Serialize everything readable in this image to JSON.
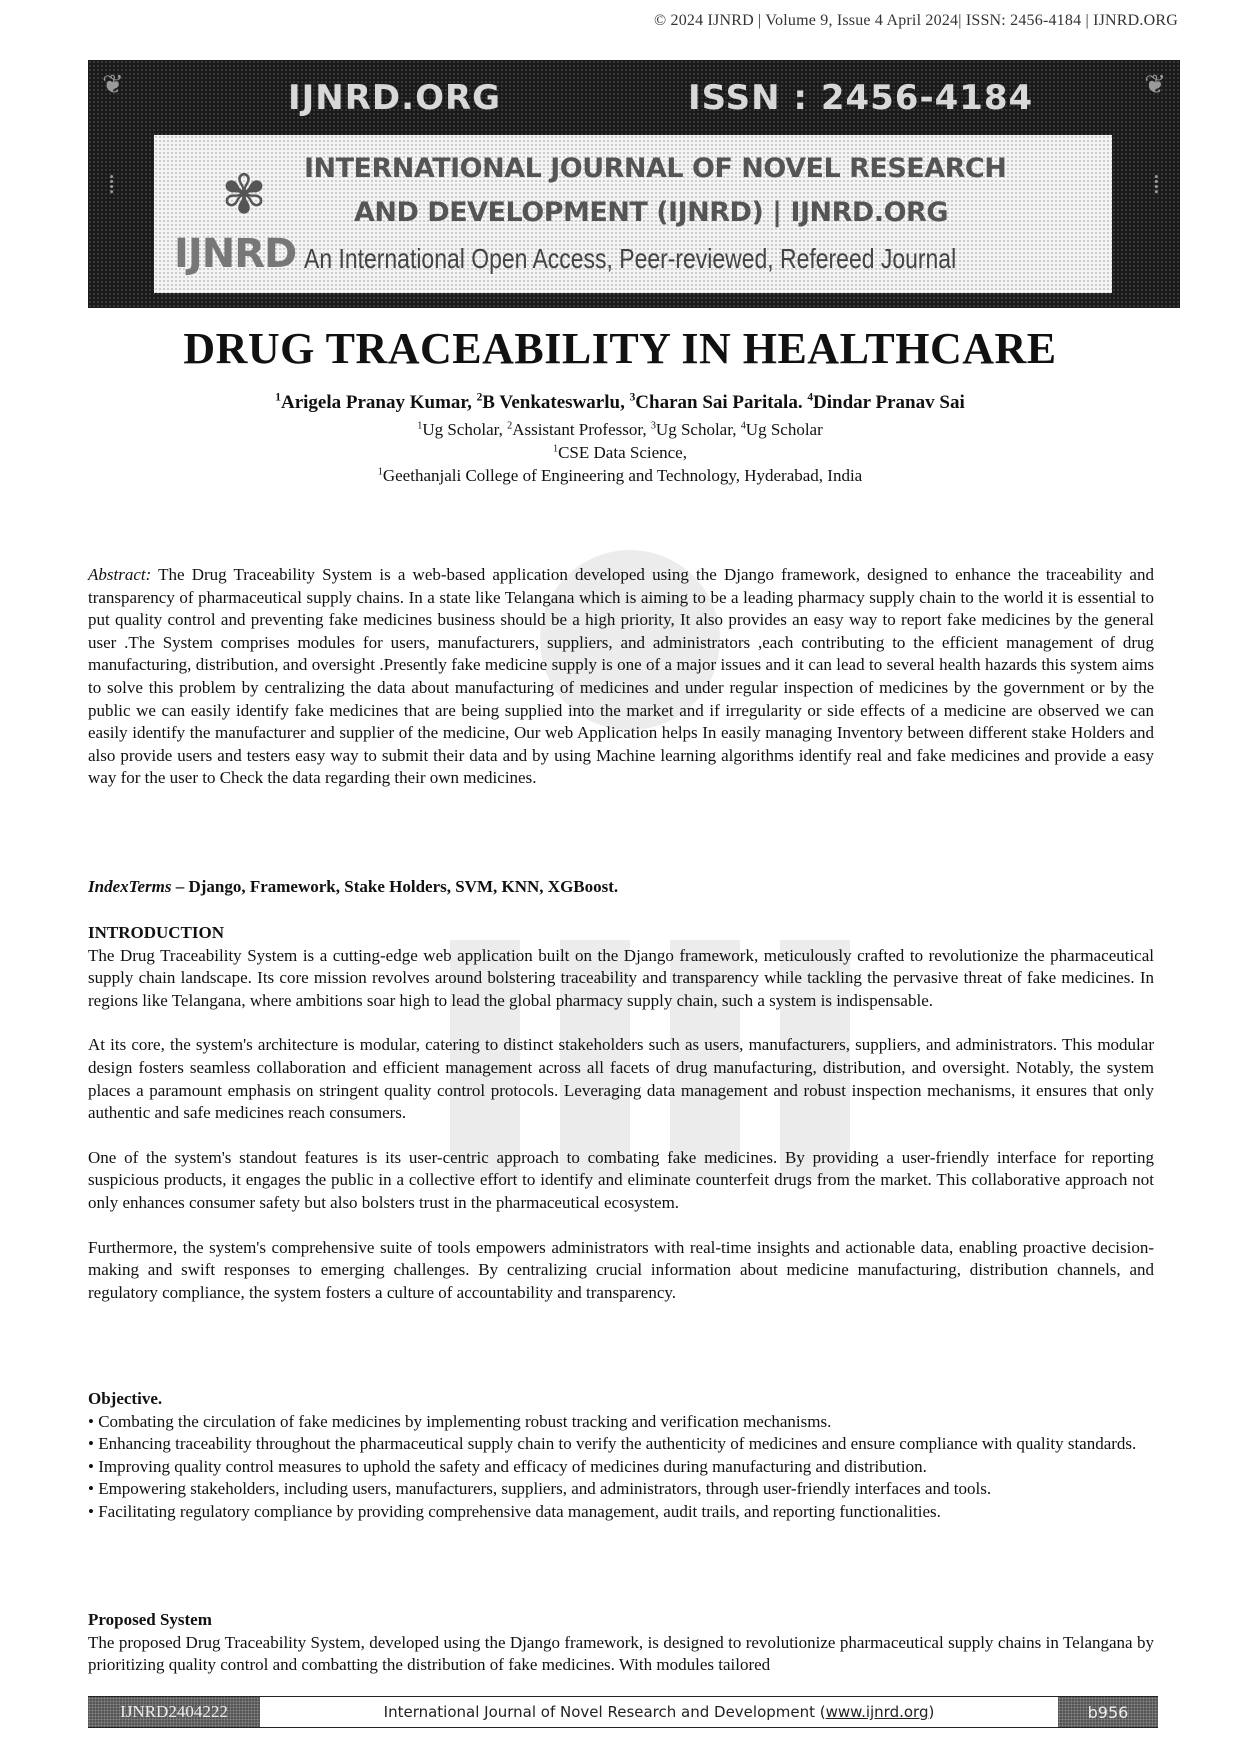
{
  "header_line": "© 2024 IJNRD | Volume 9, Issue 4 April 2024| ISSN: 2456-4184 | IJNRD.ORG",
  "banner": {
    "site": "IJNRD.ORG",
    "issn": "ISSN : 2456-4184",
    "journal_line1": "INTERNATIONAL JOURNAL OF NOVEL RESEARCH",
    "journal_line2": "AND DEVELOPMENT (IJNRD) | IJNRD.ORG",
    "tagline": "An International Open Access, Peer-reviewed, Refereed Journal",
    "logo_text": "IJNRD"
  },
  "paper": {
    "title": "DRUG TRACEABILITY IN HEALTHCARE",
    "authors": [
      {
        "sup": "1",
        "name": "Arigela Pranay Kumar, "
      },
      {
        "sup": "2",
        "name": "B Venkateswarlu, "
      },
      {
        "sup": "3",
        "name": "Charan Sai Paritala. "
      },
      {
        "sup": "4",
        "name": "Dindar Pranav Sai"
      }
    ],
    "roles": [
      {
        "sup": "1",
        "text": "Ug Scholar, "
      },
      {
        "sup": "2",
        "text": "Assistant Professor, "
      },
      {
        "sup": "3",
        "text": "Ug Scholar, "
      },
      {
        "sup": "4",
        "text": "Ug Scholar"
      }
    ],
    "dept": {
      "sup": "1",
      "text": "CSE Data Science,"
    },
    "institution": {
      "sup": "1",
      "text": "Geethanjali College of Engineering and Technology, Hyderabad, India"
    },
    "abstract_label": "Abstract:",
    "abstract": "The Drug Traceability System is a web-based application developed using the Django framework, designed to enhance the traceability and transparency of pharmaceutical supply chains. In a state like Telangana which is aiming to be a leading pharmacy supply chain to the world it is essential to put quality control and preventing fake medicines business should be a high priority, It also provides an easy way to report fake medicines by the general user .The System comprises modules for users, manufacturers, suppliers, and administrators ,each contributing to the efficient management of drug manufacturing, distribution, and oversight .Presently fake medicine supply is one of a major issues and it can lead to several health hazards this system aims to solve this problem by centralizing the data about manufacturing of medicines and under regular inspection of medicines by the government or by the public we can easily identify fake medicines that are being supplied into the market and if irregularity or side effects of a medicine are observed we can easily identify the manufacturer and supplier of the medicine, Our web Application helps In easily managing Inventory between different stake Holders and also provide users and testers easy way to submit their data and by using Machine learning algorithms identify real and fake medicines and provide a easy way for the user to Check the data regarding their own medicines.",
    "index_terms_label": "IndexTerms",
    "index_terms": " – Django, Framework, Stake Holders, SVM, KNN, XGBoost.",
    "intro_heading": "INTRODUCTION",
    "intro_paragraphs": [
      "The Drug Traceability System is a cutting-edge web application built on the Django framework, meticulously crafted to revolutionize the pharmaceutical supply chain landscape. Its core mission revolves around bolstering traceability and transparency while tackling the pervasive threat of fake medicines. In regions like Telangana, where ambitions soar high to lead the global pharmacy supply chain, such a system is indispensable.",
      "At its core, the system's architecture is modular, catering to distinct stakeholders such as users, manufacturers, suppliers, and administrators. This modular design fosters seamless collaboration and efficient management across all facets of drug manufacturing, distribution, and oversight. Notably, the system places a paramount emphasis on stringent quality control protocols. Leveraging data management and robust inspection mechanisms, it ensures that only authentic and safe medicines reach consumers.",
      "One of the system's standout features is its user-centric approach to combating fake medicines. By providing a user-friendly interface for reporting suspicious products, it engages the public in a collective effort to identify and eliminate counterfeit drugs from the market. This collaborative approach not only enhances consumer safety but also bolsters trust in the pharmaceutical ecosystem.",
      "Furthermore, the system's comprehensive suite of tools empowers administrators with real-time insights and actionable data, enabling proactive decision-making and swift responses to emerging challenges. By centralizing crucial information about medicine manufacturing, distribution channels, and regulatory compliance, the system fosters a culture of accountability and transparency."
    ],
    "objective_heading": "Objective.",
    "objectives": [
      "Combating the circulation of fake medicines by implementing robust tracking and verification mechanisms.",
      "Enhancing traceability throughout the pharmaceutical supply chain to verify the authenticity of medicines and ensure compliance with quality standards.",
      "Improving quality control measures to uphold the safety and efficacy of medicines during manufacturing and distribution.",
      "Empowering stakeholders, including users, manufacturers, suppliers, and administrators, through user-friendly interfaces and tools.",
      "Facilitating regulatory compliance by providing comprehensive data management, audit trails, and reporting functionalities."
    ],
    "proposed_heading": "Proposed System",
    "proposed_text": "The proposed Drug Traceability System, developed using the Django framework, is designed to revolutionize pharmaceutical supply chains in Telangana by prioritizing quality control and combatting the distribution of fake medicines. With modules tailored"
  },
  "footer": {
    "paper_id": "IJNRD2404222",
    "journal_prefix": "International Journal of Novel Research and Development (",
    "journal_link": "www.ijnrd.org",
    "journal_suffix": ")",
    "page": "b956"
  }
}
